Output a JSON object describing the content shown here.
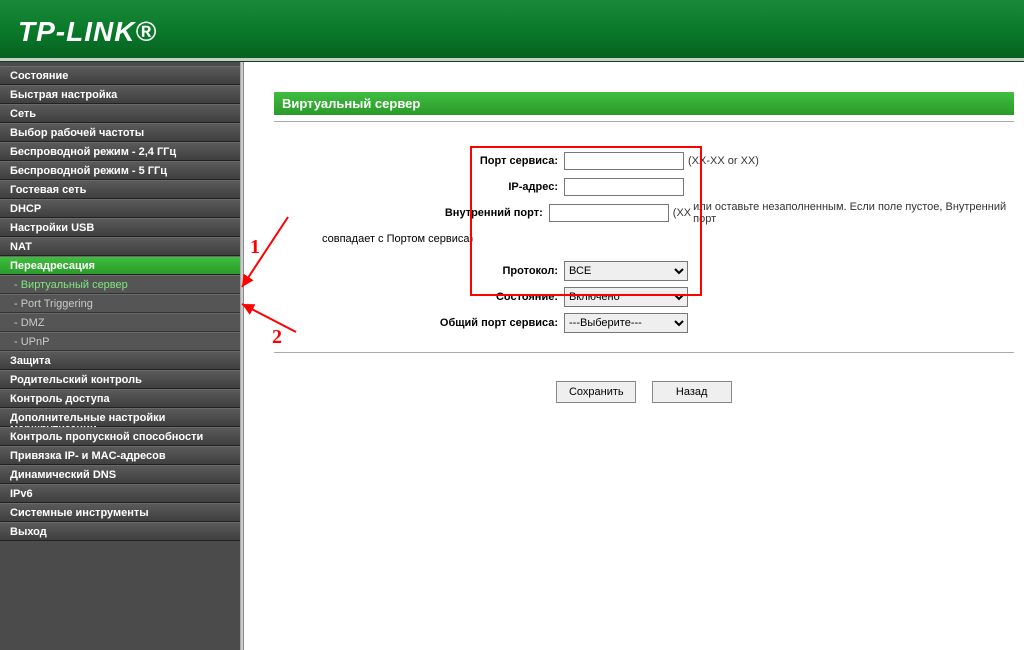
{
  "brand": "TP-LINK®",
  "sidebar": {
    "items": [
      {
        "label": "Состояние",
        "type": "item"
      },
      {
        "label": "Быстрая настройка",
        "type": "item"
      },
      {
        "label": "Сеть",
        "type": "item"
      },
      {
        "label": "Выбор рабочей частоты",
        "type": "item"
      },
      {
        "label": "Беспроводной режим - 2,4 ГГц",
        "type": "item"
      },
      {
        "label": "Беспроводной режим - 5 ГГц",
        "type": "item"
      },
      {
        "label": "Гостевая сеть",
        "type": "item"
      },
      {
        "label": "DHCP",
        "type": "item"
      },
      {
        "label": "Настройки USB",
        "type": "item"
      },
      {
        "label": "NAT",
        "type": "item"
      },
      {
        "label": "Переадресация",
        "type": "item",
        "active": true
      },
      {
        "label": "- Виртуальный сервер",
        "type": "sub",
        "selected": true
      },
      {
        "label": "- Port Triggering",
        "type": "sub"
      },
      {
        "label": "- DMZ",
        "type": "sub"
      },
      {
        "label": "- UPnP",
        "type": "sub"
      },
      {
        "label": "Защита",
        "type": "item"
      },
      {
        "label": "Родительский контроль",
        "type": "item"
      },
      {
        "label": "Контроль доступа",
        "type": "item"
      },
      {
        "label": "Дополнительные настройки маршрутизации",
        "type": "item"
      },
      {
        "label": "Контроль пропускной способности",
        "type": "item"
      },
      {
        "label": "Привязка IP- и MAC-адресов",
        "type": "item"
      },
      {
        "label": "Динамический DNS",
        "type": "item"
      },
      {
        "label": "IPv6",
        "type": "item"
      },
      {
        "label": "Системные инструменты",
        "type": "item"
      },
      {
        "label": "Выход",
        "type": "item"
      }
    ]
  },
  "content": {
    "title": "Виртуальный сервер",
    "fields": {
      "service_port": {
        "label": "Порт сервиса:",
        "hint": "(XX-XX or XX)"
      },
      "ip": {
        "label": "IP-адрес:"
      },
      "internal_port": {
        "label": "Внутренний порт:",
        "hint_prefix": "(XX",
        "hint_suffix": "или оставьте незаполненным. Если поле пустое, Внутренний порт"
      },
      "match_note": "совпадает с Портом сервиса)",
      "protocol": {
        "label": "Протокол:",
        "value": "ВСЕ"
      },
      "state": {
        "label": "Состояние:",
        "value": "Включено"
      },
      "common": {
        "label": "Общий порт сервиса:",
        "value": "---Выберите---"
      }
    },
    "buttons": {
      "save": "Сохранить",
      "back": "Назад"
    }
  },
  "annotations": {
    "one": "1",
    "two": "2"
  }
}
